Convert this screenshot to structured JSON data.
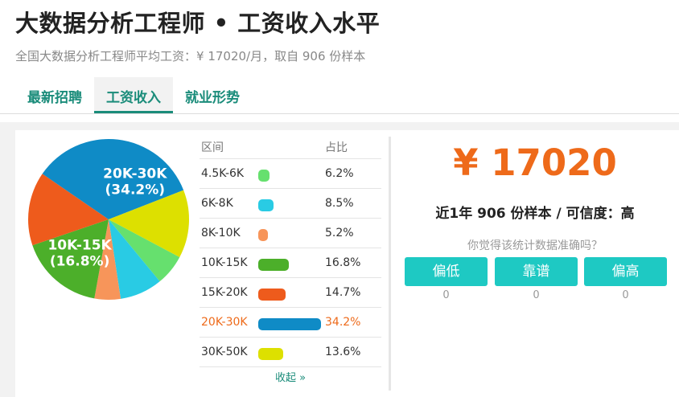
{
  "page": {
    "title": "大数据分析工程师 • 工资收入水平",
    "subtitle": "全国大数据分析工程师平均工资：¥ 17020/月，取自 906 份样本"
  },
  "tabs": [
    {
      "label": "最新招聘",
      "active": false
    },
    {
      "label": "工资收入",
      "active": true
    },
    {
      "label": "就业形势",
      "active": false
    }
  ],
  "table": {
    "header_range": "区间",
    "header_pct": "占比",
    "collapse_label": "收起 »"
  },
  "chart_data": {
    "type": "pie",
    "categories": [
      "4.5K-6K",
      "6K-8K",
      "8K-10K",
      "10K-15K",
      "15K-20K",
      "20K-30K",
      "30K-50K"
    ],
    "values": [
      6.2,
      8.5,
      5.2,
      16.8,
      14.7,
      34.2,
      13.6
    ],
    "labels": [
      "6.2%",
      "8.5%",
      "5.2%",
      "16.8%",
      "14.7%",
      "34.2%",
      "13.6%"
    ],
    "colors": [
      "#66e06e",
      "#29cbe4",
      "#f7955a",
      "#4caf2a",
      "#ee5b1c",
      "#0f8bc6",
      "#dde000"
    ],
    "highlight_index": 5,
    "pie_labels": [
      {
        "index": 5,
        "line1": "20K-30K",
        "line2": "(34.2%)"
      },
      {
        "index": 3,
        "line1": "10K-15K",
        "line2": "(16.8%)"
      }
    ]
  },
  "summary": {
    "salary": "¥ 17020",
    "meta": "近1年 906 份样本 / 可信度：高",
    "question": "你觉得该统计数据准确吗？"
  },
  "votes": [
    {
      "label": "偏低",
      "count": "0"
    },
    {
      "label": "靠谱",
      "count": "0"
    },
    {
      "label": "偏高",
      "count": "0"
    }
  ]
}
